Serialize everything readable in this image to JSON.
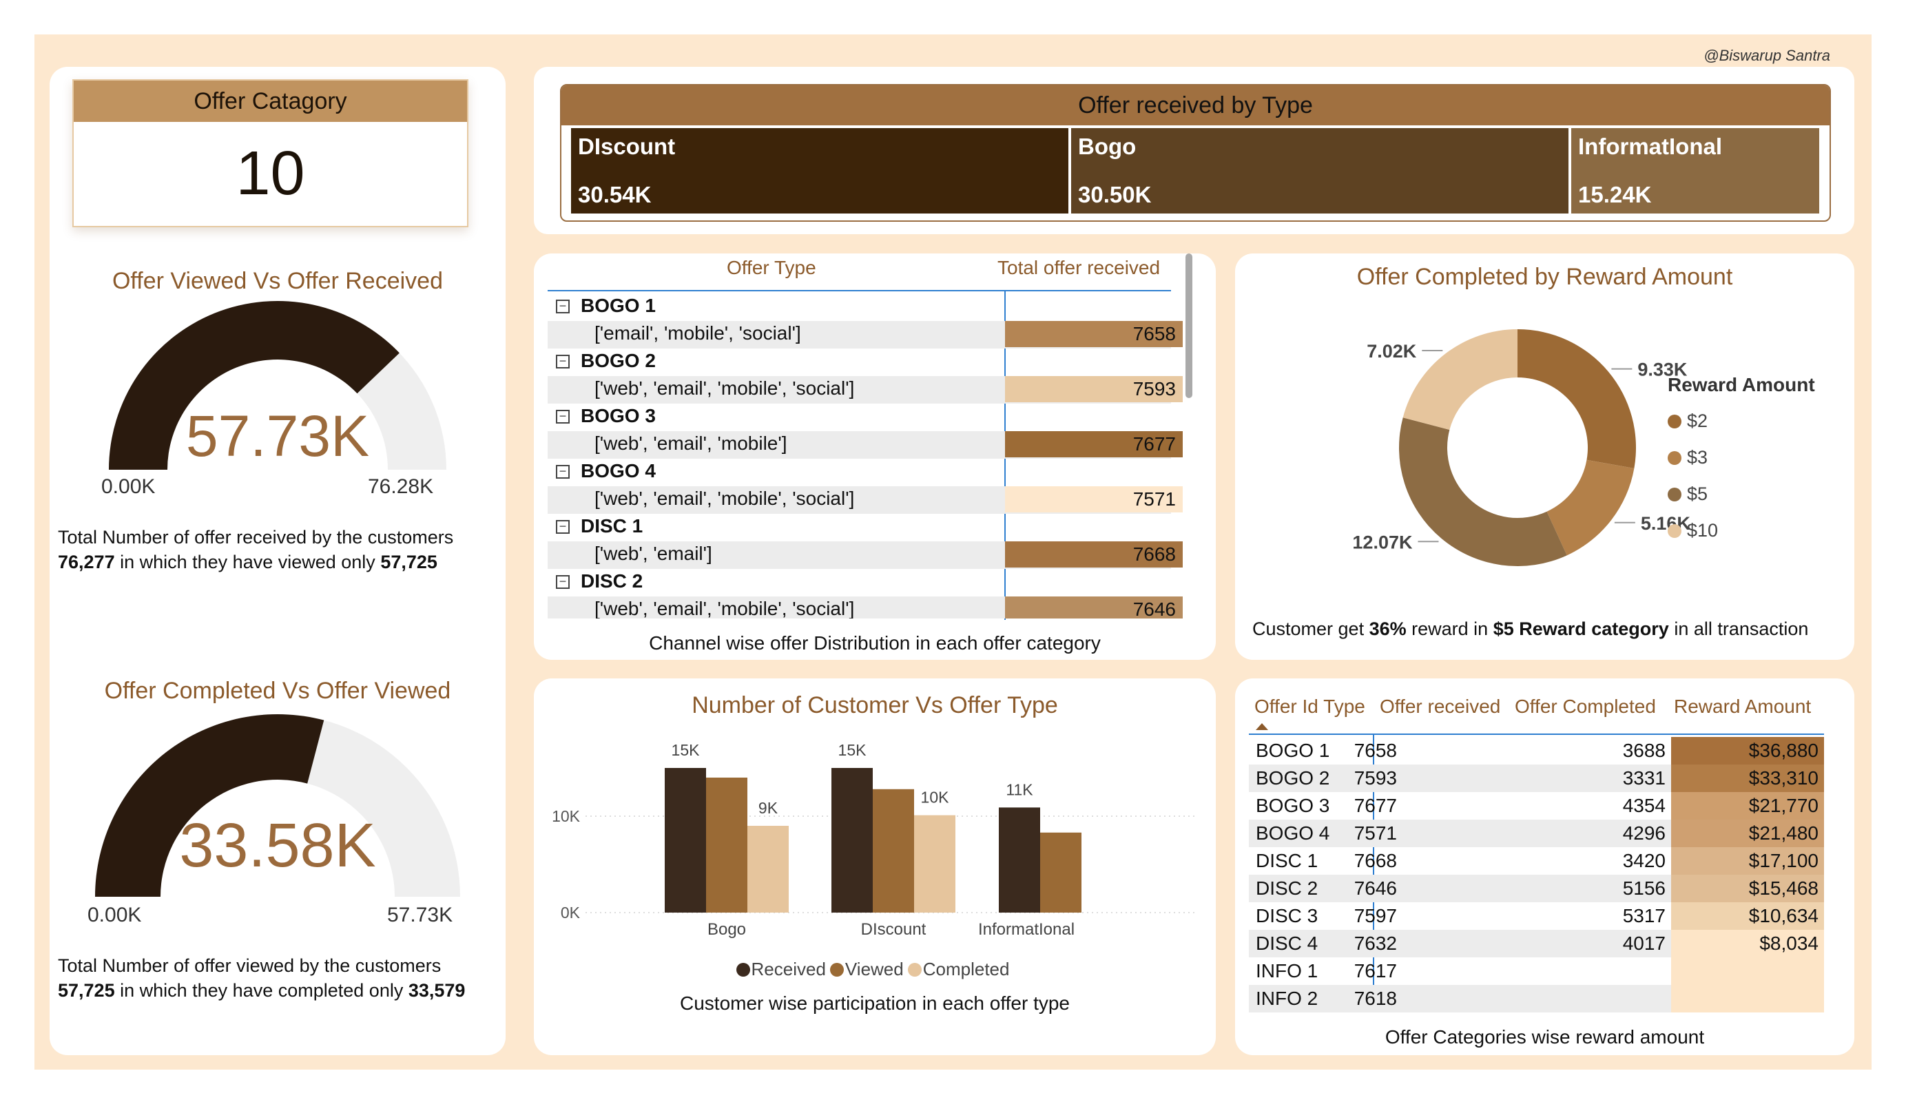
{
  "credit": "@Biswarup Santra",
  "kpi": {
    "title": "Offer Catagory",
    "value": "10"
  },
  "gauge1": {
    "title": "Offer Viewed Vs Offer Received",
    "value_label": "57.73K",
    "value": 57725,
    "max": 76277,
    "min_label": "0.00K",
    "max_label": "76.28K",
    "desc_line1": "Total Number of offer received by the customers",
    "desc_num1": "76,277",
    "desc_mid": " in which they have viewed only ",
    "desc_num2": "57,725"
  },
  "gauge2": {
    "title": "Offer Completed Vs Offer Viewed",
    "value_label": "33.58K",
    "value": 33579,
    "max": 57725,
    "min_label": "0.00K",
    "max_label": "57.73K",
    "desc_line1": "Total Number of offer viewed by the customers",
    "desc_num1": "57,725",
    "desc_mid": " in which they have completed only ",
    "desc_num2": "33,579"
  },
  "treemap": {
    "title": "Offer received by Type",
    "cells": [
      {
        "name": "DIscount",
        "value": "30.54K",
        "color": "#3d2409"
      },
      {
        "name": "Bogo",
        "value": "30.50K",
        "color": "#5e4222"
      },
      {
        "name": "InformatIonal",
        "value": "15.24K",
        "color": "#8b6a42"
      }
    ]
  },
  "matrix": {
    "col1": "Offer Type",
    "col2": "Total offer received",
    "caption": "Channel wise offer Distribution in each offer category",
    "groups": [
      {
        "name": "BOGO 1",
        "channels": "['email', 'mobile', 'social']",
        "value": "7658",
        "color": "#b48554"
      },
      {
        "name": "BOGO 2",
        "channels": "['web', 'email', 'mobile', 'social']",
        "value": "7593",
        "color": "#e8c9a2"
      },
      {
        "name": "BOGO 3",
        "channels": "['web', 'email', 'mobile']",
        "value": "7677",
        "color": "#9c6b36"
      },
      {
        "name": "BOGO 4",
        "channels": "['web', 'email', 'mobile', 'social']",
        "value": "7571",
        "color": "#fde7cc"
      },
      {
        "name": "DISC 1",
        "channels": "['web', 'email']",
        "value": "7668",
        "color": "#a57442"
      },
      {
        "name": "DISC 2",
        "channels": "['web', 'email', 'mobile', 'social']",
        "value": "7646",
        "color": "#b78d60"
      }
    ]
  },
  "donut": {
    "title": "Offer Completed by Reward Amount",
    "legend_title": "Reward Amount",
    "caption_pre": "Customer get ",
    "caption_b1": "36%",
    "caption_mid": " reward in ",
    "caption_b2": "$5 Reward category",
    "caption_post": " in all transaction",
    "slices": [
      {
        "label": "$2",
        "value": 9.33,
        "value_label": "9.33K",
        "color": "#9c6a35"
      },
      {
        "label": "$3",
        "value": 5.16,
        "value_label": "5.16K",
        "color": "#b38049"
      },
      {
        "label": "$5",
        "value": 12.07,
        "value_label": "12.07K",
        "color": "#8d6c44"
      },
      {
        "label": "$10",
        "value": 7.02,
        "value_label": "7.02K",
        "color": "#e6c59d"
      }
    ]
  },
  "chart_data": {
    "type": "bar",
    "title": "Number of Customer Vs Offer Type",
    "caption": "Customer wise participation in each offer type",
    "categories": [
      "Bogo",
      "DIscount",
      "InformatIonal"
    ],
    "yticks": [
      "0K",
      "10K"
    ],
    "ylim": [
      0,
      15000
    ],
    "series": [
      {
        "name": "Received",
        "color": "#3b2a1e",
        "values": [
          15000,
          15000,
          10900
        ],
        "labels": [
          "15K",
          "15K",
          "11K"
        ]
      },
      {
        "name": "Viewed",
        "color": "#9a6a35",
        "values": [
          14000,
          12800,
          8300
        ],
        "labels": [
          "",
          "",
          ""
        ]
      },
      {
        "name": "Completed",
        "color": "#e6c59d",
        "values": [
          9000,
          10100,
          0
        ],
        "labels": [
          "9K",
          "10K",
          ""
        ]
      }
    ]
  },
  "table": {
    "headers": [
      "Offer Id Type",
      "Offer received",
      "Offer Completed",
      "Reward Amount"
    ],
    "caption": "Offer Categories wise reward amount",
    "rows": [
      {
        "id": "BOGO 1",
        "received": "7658",
        "completed": "3688",
        "reward": "$36,880",
        "color": "#a7703b"
      },
      {
        "id": "BOGO 2",
        "received": "7593",
        "completed": "3331",
        "reward": "$33,310",
        "color": "#b27d47"
      },
      {
        "id": "BOGO 3",
        "received": "7677",
        "completed": "4354",
        "reward": "$21,770",
        "color": "#ce9e6d"
      },
      {
        "id": "BOGO 4",
        "received": "7571",
        "completed": "4296",
        "reward": "$21,480",
        "color": "#cfa071"
      },
      {
        "id": "DISC 1",
        "received": "7668",
        "completed": "3420",
        "reward": "$17,100",
        "color": "#dbb48a"
      },
      {
        "id": "DISC 2",
        "received": "7646",
        "completed": "5156",
        "reward": "$15,468",
        "color": "#e0bd95"
      },
      {
        "id": "DISC 3",
        "received": "7597",
        "completed": "5317",
        "reward": "$10,634",
        "color": "#efd3ae"
      },
      {
        "id": "DISC 4",
        "received": "7632",
        "completed": "4017",
        "reward": "$8,034",
        "color": "#fde5c7"
      },
      {
        "id": "INFO 1",
        "received": "7617",
        "completed": "",
        "reward": "",
        "color": "#fde5c7"
      },
      {
        "id": "INFO 2",
        "received": "7618",
        "completed": "",
        "reward": "",
        "color": "#fde5c7"
      }
    ]
  }
}
